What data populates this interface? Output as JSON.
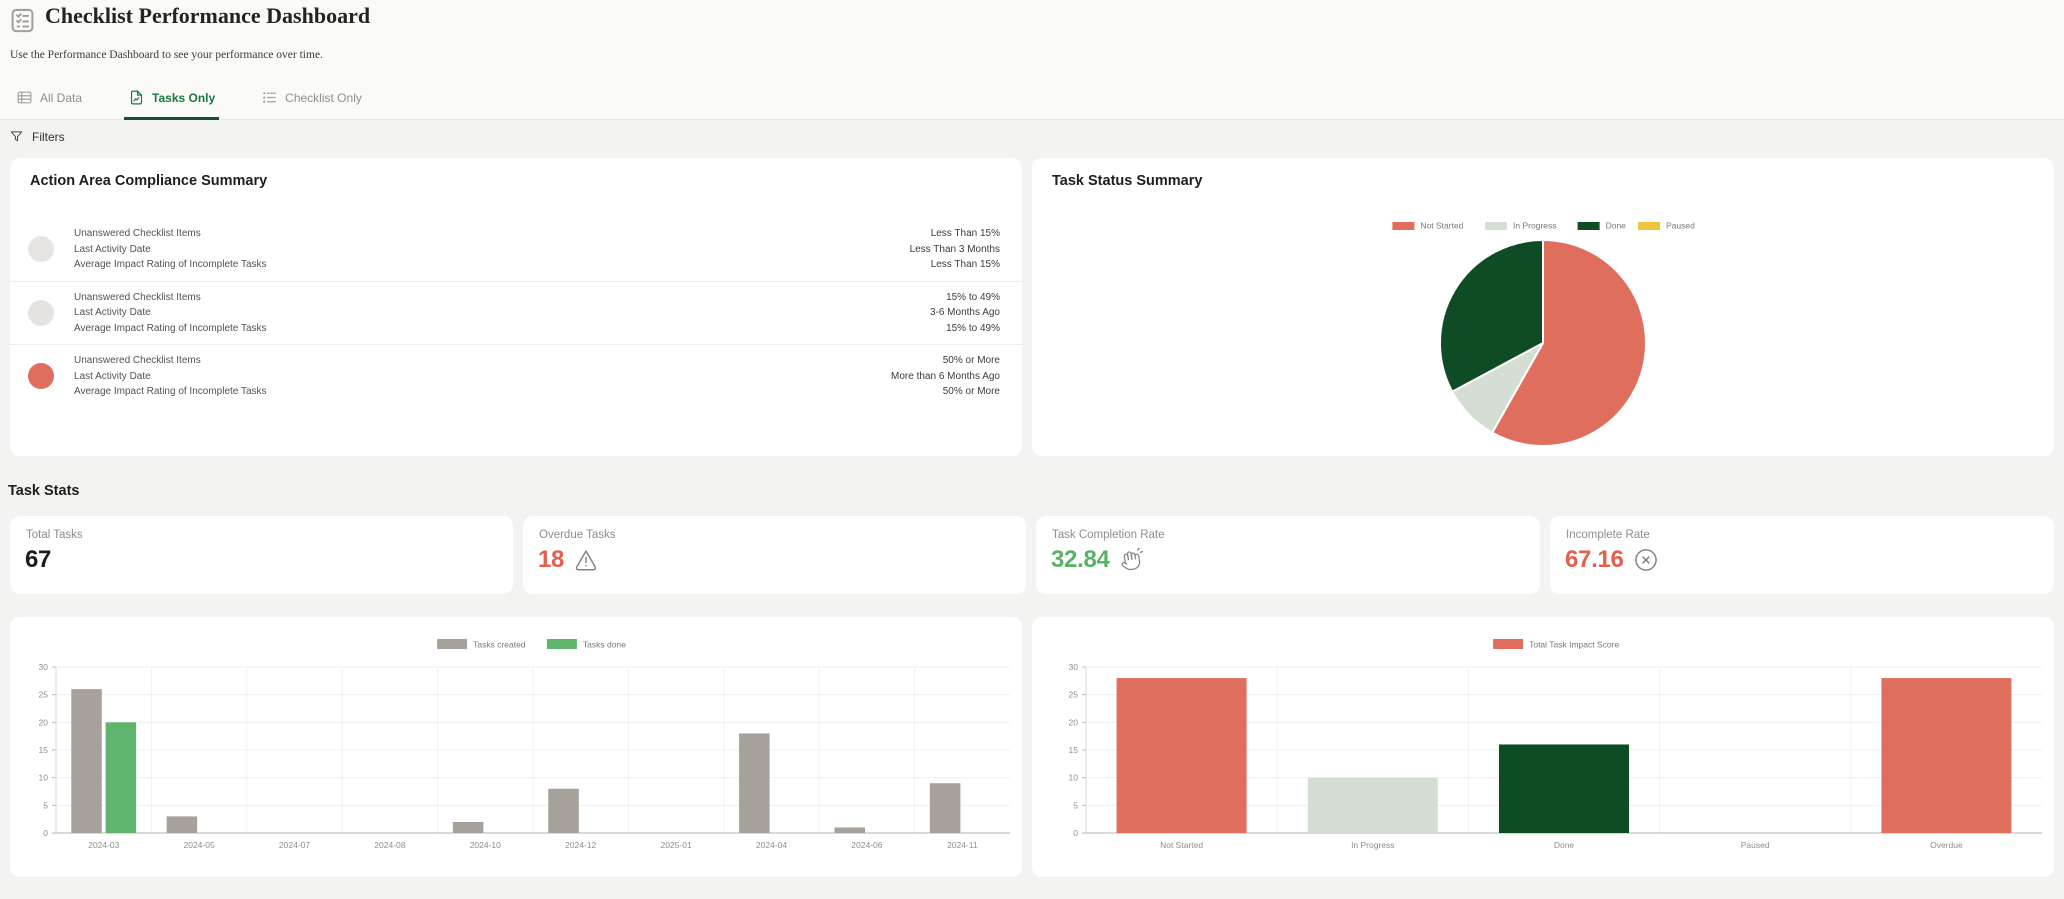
{
  "header": {
    "title": "Checklist Performance Dashboard",
    "subtitle": "Use the Performance Dashboard to see your performance over time.",
    "icon": "checklist-icon"
  },
  "tabs": [
    {
      "label": "All Data",
      "icon": "table-icon",
      "active": false
    },
    {
      "label": "Tasks Only",
      "icon": "document-icon",
      "active": true
    },
    {
      "label": "Checklist Only",
      "icon": "bullet-list-icon",
      "active": false
    }
  ],
  "filters": {
    "label": "Filters",
    "icon": "funnel-icon"
  },
  "colors": {
    "accent_green": "#1b7740",
    "salmon": "#df6e5c",
    "light_sage": "#d5ded5",
    "dark_green": "#0d4c24",
    "paused_yellow": "#eec33e",
    "bar_gray": "#a7a19c",
    "done_green": "#5fb56e",
    "stat_red": "#e2604c",
    "stat_green": "#56b365",
    "stat_dark": "#1d1d1b",
    "dot_gray": "#e5e3e1"
  },
  "compliance": {
    "title": "Action Area Compliance Summary",
    "rows": [
      {
        "dot_color": "#e7e5e3",
        "labels": [
          "Unanswered Checklist Items",
          "Last Activity Date",
          "Average Impact Rating of Incomplete Tasks"
        ],
        "values": [
          "Less Than 15%",
          "Less Than 3 Months",
          "Less Than 15%"
        ]
      },
      {
        "dot_color": "#e5e3e1",
        "labels": [
          "Unanswered Checklist Items",
          "Last Activity Date",
          "Average Impact Rating of Incomplete Tasks"
        ],
        "values": [
          "15% to 49%",
          "3-6 Months Ago",
          "15% to 49%"
        ]
      },
      {
        "dot_color": "#df6e5c",
        "labels": [
          "Unanswered Checklist Items",
          "Last Activity Date",
          "Average Impact Rating of Incomplete Tasks"
        ],
        "values": [
          "50% or More",
          "More than 6 Months Ago",
          "50% or More"
        ]
      }
    ]
  },
  "pie_card_title": "Task Status Summary",
  "task_stats": {
    "title": "Task Stats",
    "cards": [
      {
        "label": "Total Tasks",
        "value": "67",
        "color": "#1d1d1b",
        "icon": "none"
      },
      {
        "label": "Overdue Tasks",
        "value": "18",
        "color": "#e2604c",
        "icon": "warning-icon"
      },
      {
        "label": "Task Completion Rate",
        "value": "32.84",
        "color": "#56b365",
        "icon": "hand-wave-icon"
      },
      {
        "label": "Incomplete Rate",
        "value": "67.16",
        "color": "#e2604c",
        "icon": "x-circle-icon"
      }
    ]
  },
  "chart_data": [
    {
      "id": "task-status-pie",
      "type": "pie",
      "title": "Task Status Summary",
      "labels": [
        "Not Started",
        "In Progress",
        "Done",
        "Paused"
      ],
      "values": [
        39,
        6,
        22,
        0
      ],
      "percents": [
        58.2,
        9.0,
        32.8,
        0
      ],
      "colors": [
        "#df6e5c",
        "#d5ded5",
        "#0d4c24",
        "#eec33e"
      ],
      "legend_position": "top",
      "start_angle_deg": -90,
      "direction": "clockwise"
    },
    {
      "id": "tasks-by-month",
      "type": "bar",
      "categories": [
        "2024-03",
        "2024-05",
        "2024-07",
        "2024-08",
        "2024-10",
        "2024-12",
        "2025-01",
        "2024-04",
        "2024-06",
        "2024-11"
      ],
      "series": [
        {
          "name": "Tasks created",
          "color": "#a7a19c",
          "values": [
            26,
            3,
            0,
            0,
            2,
            8,
            0,
            18,
            1,
            9
          ]
        },
        {
          "name": "Tasks done",
          "color": "#5fb56e",
          "values": [
            20,
            0,
            0,
            0,
            0,
            0,
            0,
            0,
            0,
            0
          ]
        }
      ],
      "ylim": [
        0,
        30
      ],
      "yticks": [
        0,
        5,
        10,
        15,
        20,
        25,
        30
      ],
      "grid": true,
      "legend_position": "top"
    },
    {
      "id": "impact-by-status",
      "type": "bar",
      "categories": [
        "Not Started",
        "In Progress",
        "Done",
        "Paused",
        "Overdue"
      ],
      "series": [
        {
          "name": "Total Task Impact Score",
          "color": "#df6e5c",
          "values": [
            28,
            10,
            16,
            0,
            28
          ],
          "bar_colors": [
            "#df6e5c",
            "#d5ded5",
            "#0d4c24",
            "#eec33e",
            "#df6e5c"
          ]
        }
      ],
      "ylim": [
        0,
        30
      ],
      "yticks": [
        0,
        5,
        10,
        15,
        20,
        25,
        30
      ],
      "grid": true,
      "legend_position": "top"
    }
  ]
}
